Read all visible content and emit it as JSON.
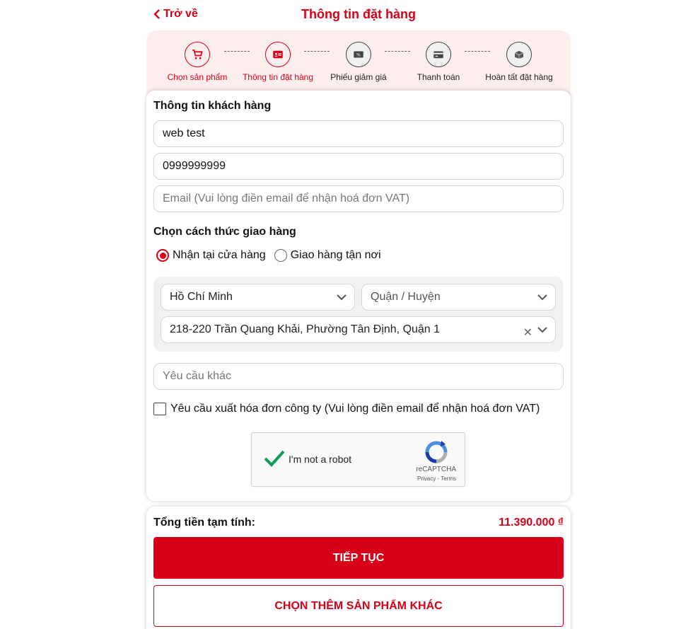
{
  "header": {
    "back_label": "Trở về",
    "title": "Thông tin đặt hàng"
  },
  "steps": [
    {
      "label": "Chọn sản phẩm",
      "icon": "cart-icon",
      "active": true
    },
    {
      "label": "Thông tin đặt hàng",
      "icon": "id-card-icon",
      "active": true
    },
    {
      "label": "Phiếu giảm giá",
      "icon": "coupon-icon",
      "active": false
    },
    {
      "label": "Thanh toán",
      "icon": "credit-card-icon",
      "active": false
    },
    {
      "label": "Hoàn tất đặt hàng",
      "icon": "package-icon",
      "active": false
    }
  ],
  "customer": {
    "section_title": "Thông tin khách hàng",
    "name_value": "web test",
    "phone_value": "0999999999",
    "email_placeholder": "Email (Vui lòng điền email để nhận hoá đơn VAT)"
  },
  "delivery": {
    "section_title": "Chọn cách thức giao hàng",
    "option_store": "Nhận tại cửa hàng",
    "option_home": "Giao hàng tận nơi",
    "selected": "store",
    "city": "Hồ Chí Minh",
    "district_placeholder": "Quận / Huyện",
    "store_address": "218-220 Trần Quang Khải, Phường Tân Định, Quận 1",
    "other_request_placeholder": "Yêu cầu khác",
    "invoice_checkbox_label": "Yêu cầu xuất hóa đơn công ty (Vui lòng điền email để nhận hoá đơn VAT)"
  },
  "captcha": {
    "label": "I'm not a robot",
    "brand": "reCAPTCHA",
    "terms": "Privacy - Terms"
  },
  "summary": {
    "total_label": "Tổng tiền tạm tính:",
    "total_value": "11.390.000 ₫",
    "continue_button": "TIẾP TỤC",
    "more_products_button": "CHỌN THÊM SẢN PHẨM KHÁC"
  },
  "colors": {
    "accent": "#d70018",
    "step_bar_bg": "#fdeeee",
    "captcha_check": "#0f9d58"
  }
}
